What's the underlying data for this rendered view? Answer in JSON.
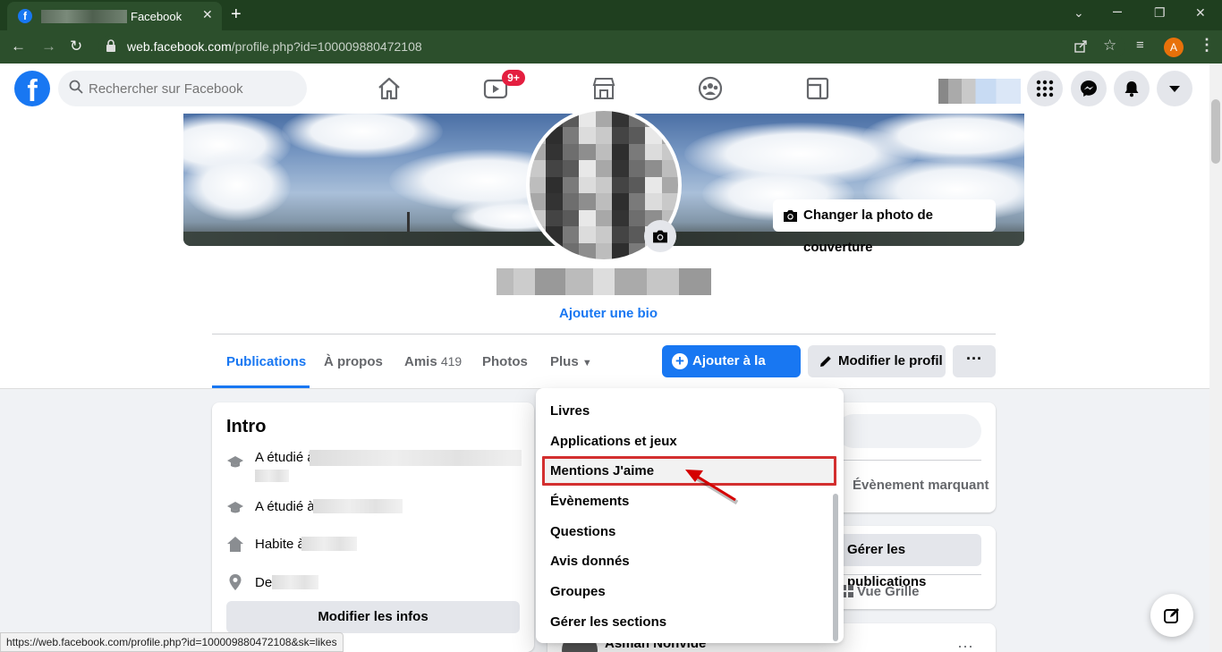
{
  "browser": {
    "tab_title": "Facebook",
    "tab_close": "✕",
    "new_tab": "+",
    "url_host": "web.facebook.com",
    "url_path": "/profile.php?id=100009880472108",
    "profile_initial": "A",
    "status_url": "https://web.facebook.com/profile.php?id=100009880472108&sk=likes"
  },
  "header": {
    "search_placeholder": "Rechercher sur Facebook",
    "watch_badge": "9+"
  },
  "profile": {
    "cover_button": "Changer la photo de couverture",
    "add_bio": "Ajouter une bio",
    "tabs": [
      {
        "label": "Publications"
      },
      {
        "label": "À propos"
      },
      {
        "label": "Amis",
        "count": "419"
      },
      {
        "label": "Photos"
      },
      {
        "label": "Plus"
      }
    ],
    "add_story": "Ajouter à la story",
    "edit_profile": "Modifier le profil",
    "more": "···"
  },
  "intro": {
    "title": "Intro",
    "rows": [
      {
        "icon": "graduation-cap-icon",
        "text": "A étudié à"
      },
      {
        "icon": "graduation-cap-icon",
        "text": "A étudié à"
      },
      {
        "icon": "home-icon",
        "text": "Habite à"
      },
      {
        "icon": "location-pin-icon",
        "text": "De"
      }
    ],
    "edit_button": "Modifier les infos"
  },
  "right": {
    "event": "Évènement marquant",
    "manage_posts": "Gérer les publications",
    "grid_view": "Vue Grille",
    "post_author": "Asmah Nohvide"
  },
  "plus_menu": {
    "items": [
      "Livres",
      "Applications et jeux",
      "Mentions J'aime",
      "Évènements",
      "Questions",
      "Avis donnés",
      "Groupes",
      "Gérer les sections"
    ],
    "highlighted": "Mentions J'aime"
  },
  "colors": {
    "facebook_blue": "#1877f2",
    "highlight_red": "#d32f2f",
    "browser_green": "#1f3f1f"
  }
}
